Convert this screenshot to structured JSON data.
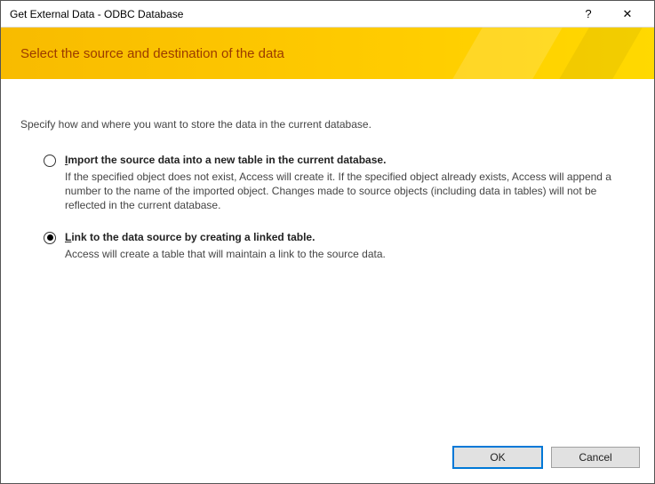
{
  "titlebar": {
    "title": "Get External Data - ODBC Database",
    "help": "?",
    "close": "✕"
  },
  "banner": {
    "title": "Select the source and destination of the data"
  },
  "content": {
    "instruction": "Specify how and where you want to store the data in the current database.",
    "options": [
      {
        "checked": false,
        "label_prefix": "I",
        "label_rest": "mport the source data into a new table in the current database.",
        "desc": "If the specified object does not exist, Access will create it. If the specified object already exists, Access will append a number to the name of the imported object. Changes made to source objects (including data in tables) will not be reflected in the current database."
      },
      {
        "checked": true,
        "label_prefix": "L",
        "label_rest": "ink to the data source by creating a linked table.",
        "desc": "Access will create a table that will maintain a link to the source data."
      }
    ]
  },
  "footer": {
    "ok": "OK",
    "cancel": "Cancel"
  }
}
